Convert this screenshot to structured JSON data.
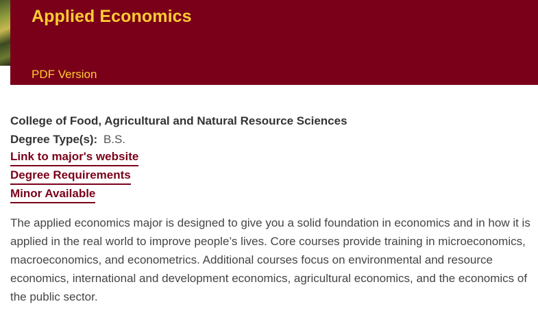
{
  "banner": {
    "title": "Applied Economics",
    "pdf_link": "PDF Version"
  },
  "program": {
    "college": "College of Food, Agricultural and Natural Resource Sciences",
    "degree_label": "Degree Type(s):",
    "degree_value": "B.S.",
    "links": [
      "Link to major's website",
      "Degree Requirements",
      "Minor Available"
    ],
    "description": "The applied economics major is designed to give you a solid foundation in economics and in how it is applied in the real world to improve people’s lives. Core courses provide training in microeconomics, macroeconomics, and econometrics. Additional courses focus on environmental and resource economics, international and development economics, agricultural economics, and the economics of the public sector."
  },
  "colors": {
    "brand_maroon": "#7a0019",
    "brand_gold": "#ffcc33"
  }
}
